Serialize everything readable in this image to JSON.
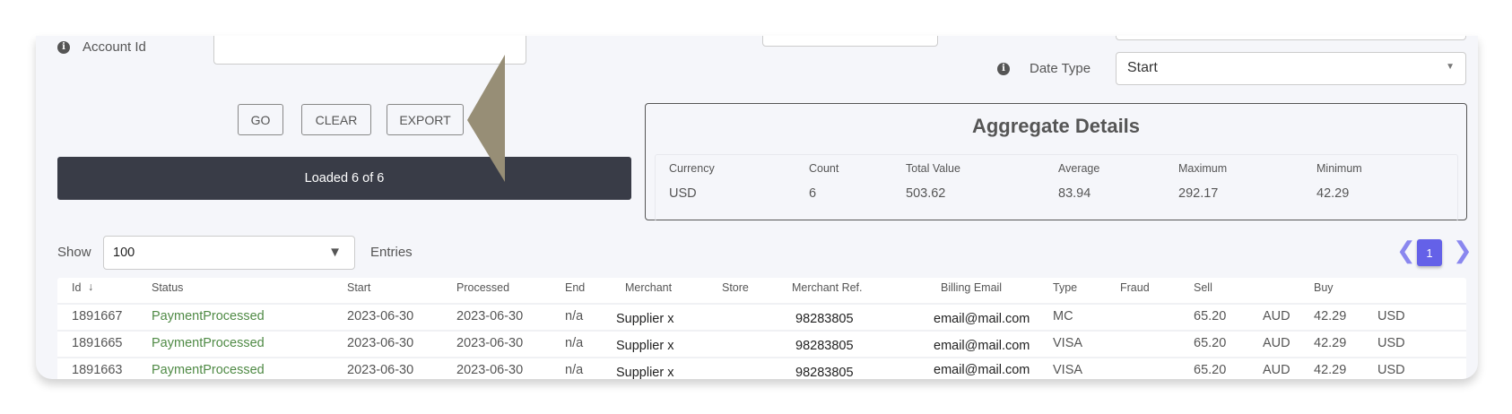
{
  "filters": {
    "account_id_label": "Account Id",
    "account_id_value": "",
    "date_type_label": "Date Type",
    "date_type_value": "Start"
  },
  "buttons": {
    "go": "GO",
    "clear": "CLEAR",
    "export": "EXPORT"
  },
  "status": {
    "loaded": "Loaded 6 of 6"
  },
  "aggregate": {
    "title": "Aggregate Details",
    "headers": [
      "Currency",
      "Count",
      "Total Value",
      "Average",
      "Maximum",
      "Minimum"
    ],
    "values": [
      "USD",
      "6",
      "503.62",
      "83.94",
      "292.17",
      "42.29"
    ]
  },
  "entries": {
    "show_label": "Show",
    "value": "100",
    "entries_label": "Entries"
  },
  "pagination": {
    "current": "1"
  },
  "table": {
    "headers": [
      "Id",
      "Status",
      "Start",
      "Processed",
      "End",
      "Merchant",
      "Store",
      "Merchant Ref.",
      "Billing Email",
      "Type",
      "Fraud",
      "Sell",
      "",
      "Buy",
      ""
    ],
    "rows": [
      [
        "1891667",
        "PaymentProcessed",
        "2023-06-30",
        "2023-06-30",
        "n/a",
        "Supplier x",
        "",
        "98283805",
        "email@mail.com",
        "MC",
        "",
        "65.20",
        "AUD",
        "42.29",
        "USD"
      ],
      [
        "1891665",
        "PaymentProcessed",
        "2023-06-30",
        "2023-06-30",
        "n/a",
        "Supplier x",
        "",
        "98283805",
        "email@mail.com",
        "VISA",
        "",
        "65.20",
        "AUD",
        "42.29",
        "USD"
      ],
      [
        "1891663",
        "PaymentProcessed",
        "2023-06-30",
        "2023-06-30",
        "n/a",
        "Supplier x",
        "",
        "98283805",
        "email@mail.com",
        "VISA",
        "",
        "65.20",
        "AUD",
        "42.29",
        "USD"
      ]
    ]
  },
  "colors": {
    "accent": "#6461e8",
    "status_bar": "#393c47",
    "pointer": "#978e76",
    "status_green": "#4f8a45"
  }
}
